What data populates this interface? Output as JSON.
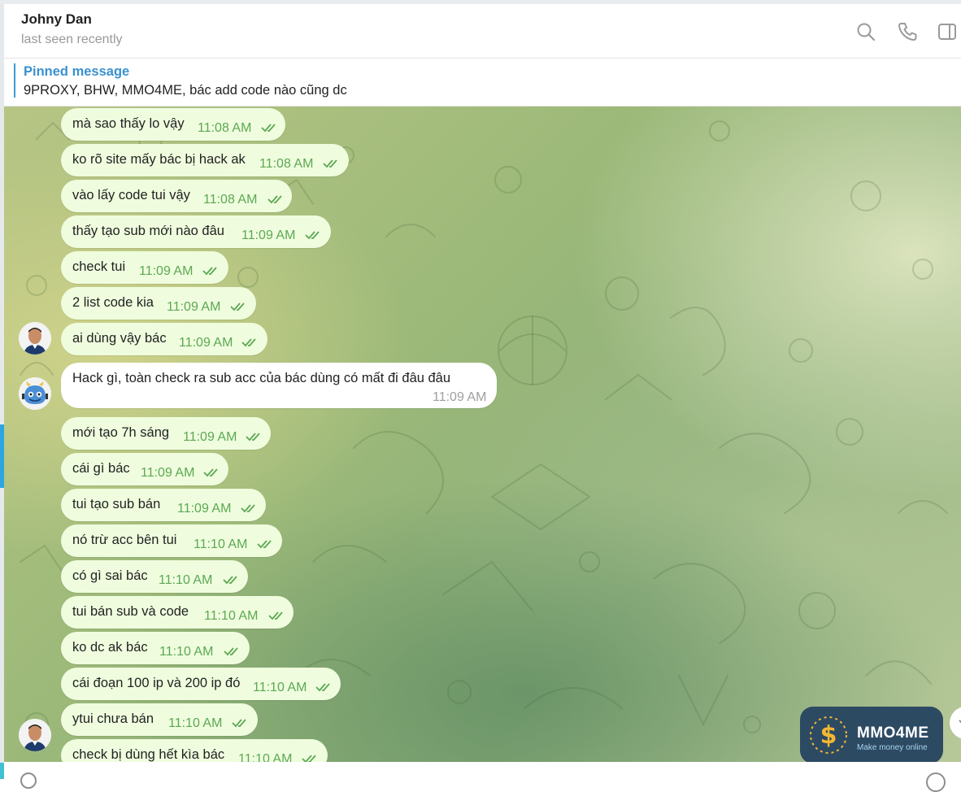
{
  "header": {
    "name": "Johny Dan",
    "status": "last seen recently",
    "icons": [
      "search-icon",
      "phone-icon",
      "sidebar-toggle-icon"
    ]
  },
  "pinned": {
    "title": "Pinned message",
    "text": "9PROXY, BHW, MMO4ME, bác add code nào cũng dc"
  },
  "messages": [
    {
      "text": "mà sao thấy lo vậy",
      "time": "11:08 AM"
    },
    {
      "text": "ko rõ site mấy bác bị hack ak",
      "time": "11:08 AM"
    },
    {
      "text": "vào lấy code tui vậy",
      "time": "11:08 AM"
    },
    {
      "text": "thấy tạo sub mới nào đâu",
      "time": "11:09 AM"
    },
    {
      "text": "check tui",
      "time": "11:09 AM"
    },
    {
      "text": "2 list code kia",
      "time": "11:09 AM"
    },
    {
      "text": "ai dùng vậy bác",
      "time": "11:09 AM"
    },
    {
      "text": "Hack gì, toàn check ra sub acc của bác dùng có mất đi đâu đâu",
      "time": "11:09 AM"
    },
    {
      "text": "mới tạo 7h sáng",
      "time": "11:09 AM"
    },
    {
      "text": "cái gì bác",
      "time": "11:09 AM"
    },
    {
      "text": "tui tạo sub bán",
      "time": "11:09 AM"
    },
    {
      "text": "nó trừ acc bên tui",
      "time": "11:10 AM"
    },
    {
      "text": "có gì sai bác",
      "time": "11:10 AM"
    },
    {
      "text": "tui bán sub và code",
      "time": "11:10 AM"
    },
    {
      "text": "ko dc ak bác",
      "time": "11:10 AM"
    },
    {
      "text": "cái đoạn 100 ip và 200 ip đó",
      "time": "11:10 AM"
    },
    {
      "text": "ytui chưa bán",
      "time": "11:10 AM"
    },
    {
      "text": "check bị dùng hết kìa bác",
      "time": "11:10 AM"
    }
  ],
  "logo": {
    "title": "MMO4ME",
    "subtitle": "Make money online"
  },
  "colors": {
    "outgoing_bubble": "#effdde",
    "incoming_bubble": "#ffffff",
    "time_outgoing": "#5ca853",
    "time_incoming": "#a0a0a0",
    "accent": "#3a91cf"
  }
}
